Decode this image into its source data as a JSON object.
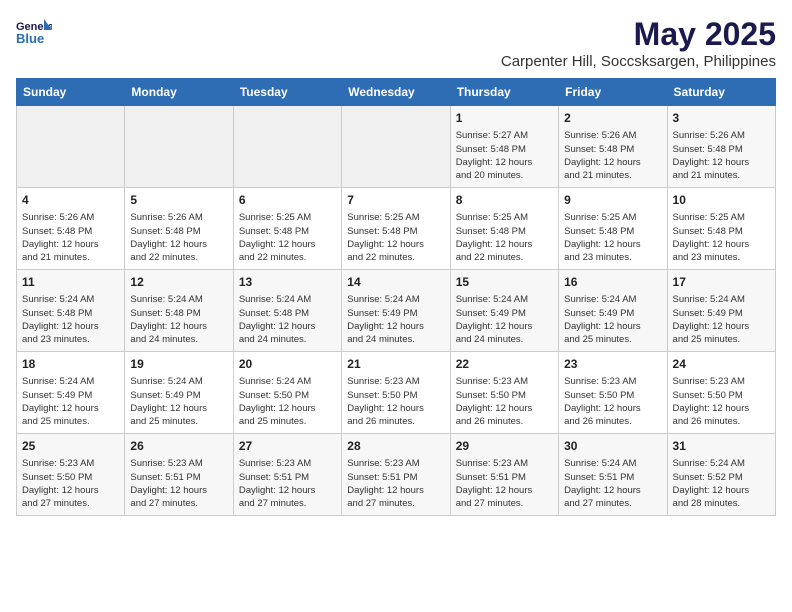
{
  "logo": {
    "line1": "General",
    "line2": "Blue"
  },
  "title": "May 2025",
  "location": "Carpenter Hill, Soccsksargen, Philippines",
  "days_of_week": [
    "Sunday",
    "Monday",
    "Tuesday",
    "Wednesday",
    "Thursday",
    "Friday",
    "Saturday"
  ],
  "weeks": [
    [
      {
        "day": "",
        "content": ""
      },
      {
        "day": "",
        "content": ""
      },
      {
        "day": "",
        "content": ""
      },
      {
        "day": "",
        "content": ""
      },
      {
        "day": "1",
        "content": "Sunrise: 5:27 AM\nSunset: 5:48 PM\nDaylight: 12 hours\nand 20 minutes."
      },
      {
        "day": "2",
        "content": "Sunrise: 5:26 AM\nSunset: 5:48 PM\nDaylight: 12 hours\nand 21 minutes."
      },
      {
        "day": "3",
        "content": "Sunrise: 5:26 AM\nSunset: 5:48 PM\nDaylight: 12 hours\nand 21 minutes."
      }
    ],
    [
      {
        "day": "4",
        "content": "Sunrise: 5:26 AM\nSunset: 5:48 PM\nDaylight: 12 hours\nand 21 minutes."
      },
      {
        "day": "5",
        "content": "Sunrise: 5:26 AM\nSunset: 5:48 PM\nDaylight: 12 hours\nand 22 minutes."
      },
      {
        "day": "6",
        "content": "Sunrise: 5:25 AM\nSunset: 5:48 PM\nDaylight: 12 hours\nand 22 minutes."
      },
      {
        "day": "7",
        "content": "Sunrise: 5:25 AM\nSunset: 5:48 PM\nDaylight: 12 hours\nand 22 minutes."
      },
      {
        "day": "8",
        "content": "Sunrise: 5:25 AM\nSunset: 5:48 PM\nDaylight: 12 hours\nand 22 minutes."
      },
      {
        "day": "9",
        "content": "Sunrise: 5:25 AM\nSunset: 5:48 PM\nDaylight: 12 hours\nand 23 minutes."
      },
      {
        "day": "10",
        "content": "Sunrise: 5:25 AM\nSunset: 5:48 PM\nDaylight: 12 hours\nand 23 minutes."
      }
    ],
    [
      {
        "day": "11",
        "content": "Sunrise: 5:24 AM\nSunset: 5:48 PM\nDaylight: 12 hours\nand 23 minutes."
      },
      {
        "day": "12",
        "content": "Sunrise: 5:24 AM\nSunset: 5:48 PM\nDaylight: 12 hours\nand 24 minutes."
      },
      {
        "day": "13",
        "content": "Sunrise: 5:24 AM\nSunset: 5:48 PM\nDaylight: 12 hours\nand 24 minutes."
      },
      {
        "day": "14",
        "content": "Sunrise: 5:24 AM\nSunset: 5:49 PM\nDaylight: 12 hours\nand 24 minutes."
      },
      {
        "day": "15",
        "content": "Sunrise: 5:24 AM\nSunset: 5:49 PM\nDaylight: 12 hours\nand 24 minutes."
      },
      {
        "day": "16",
        "content": "Sunrise: 5:24 AM\nSunset: 5:49 PM\nDaylight: 12 hours\nand 25 minutes."
      },
      {
        "day": "17",
        "content": "Sunrise: 5:24 AM\nSunset: 5:49 PM\nDaylight: 12 hours\nand 25 minutes."
      }
    ],
    [
      {
        "day": "18",
        "content": "Sunrise: 5:24 AM\nSunset: 5:49 PM\nDaylight: 12 hours\nand 25 minutes."
      },
      {
        "day": "19",
        "content": "Sunrise: 5:24 AM\nSunset: 5:49 PM\nDaylight: 12 hours\nand 25 minutes."
      },
      {
        "day": "20",
        "content": "Sunrise: 5:24 AM\nSunset: 5:50 PM\nDaylight: 12 hours\nand 25 minutes."
      },
      {
        "day": "21",
        "content": "Sunrise: 5:23 AM\nSunset: 5:50 PM\nDaylight: 12 hours\nand 26 minutes."
      },
      {
        "day": "22",
        "content": "Sunrise: 5:23 AM\nSunset: 5:50 PM\nDaylight: 12 hours\nand 26 minutes."
      },
      {
        "day": "23",
        "content": "Sunrise: 5:23 AM\nSunset: 5:50 PM\nDaylight: 12 hours\nand 26 minutes."
      },
      {
        "day": "24",
        "content": "Sunrise: 5:23 AM\nSunset: 5:50 PM\nDaylight: 12 hours\nand 26 minutes."
      }
    ],
    [
      {
        "day": "25",
        "content": "Sunrise: 5:23 AM\nSunset: 5:50 PM\nDaylight: 12 hours\nand 27 minutes."
      },
      {
        "day": "26",
        "content": "Sunrise: 5:23 AM\nSunset: 5:51 PM\nDaylight: 12 hours\nand 27 minutes."
      },
      {
        "day": "27",
        "content": "Sunrise: 5:23 AM\nSunset: 5:51 PM\nDaylight: 12 hours\nand 27 minutes."
      },
      {
        "day": "28",
        "content": "Sunrise: 5:23 AM\nSunset: 5:51 PM\nDaylight: 12 hours\nand 27 minutes."
      },
      {
        "day": "29",
        "content": "Sunrise: 5:23 AM\nSunset: 5:51 PM\nDaylight: 12 hours\nand 27 minutes."
      },
      {
        "day": "30",
        "content": "Sunrise: 5:24 AM\nSunset: 5:51 PM\nDaylight: 12 hours\nand 27 minutes."
      },
      {
        "day": "31",
        "content": "Sunrise: 5:24 AM\nSunset: 5:52 PM\nDaylight: 12 hours\nand 28 minutes."
      }
    ]
  ]
}
